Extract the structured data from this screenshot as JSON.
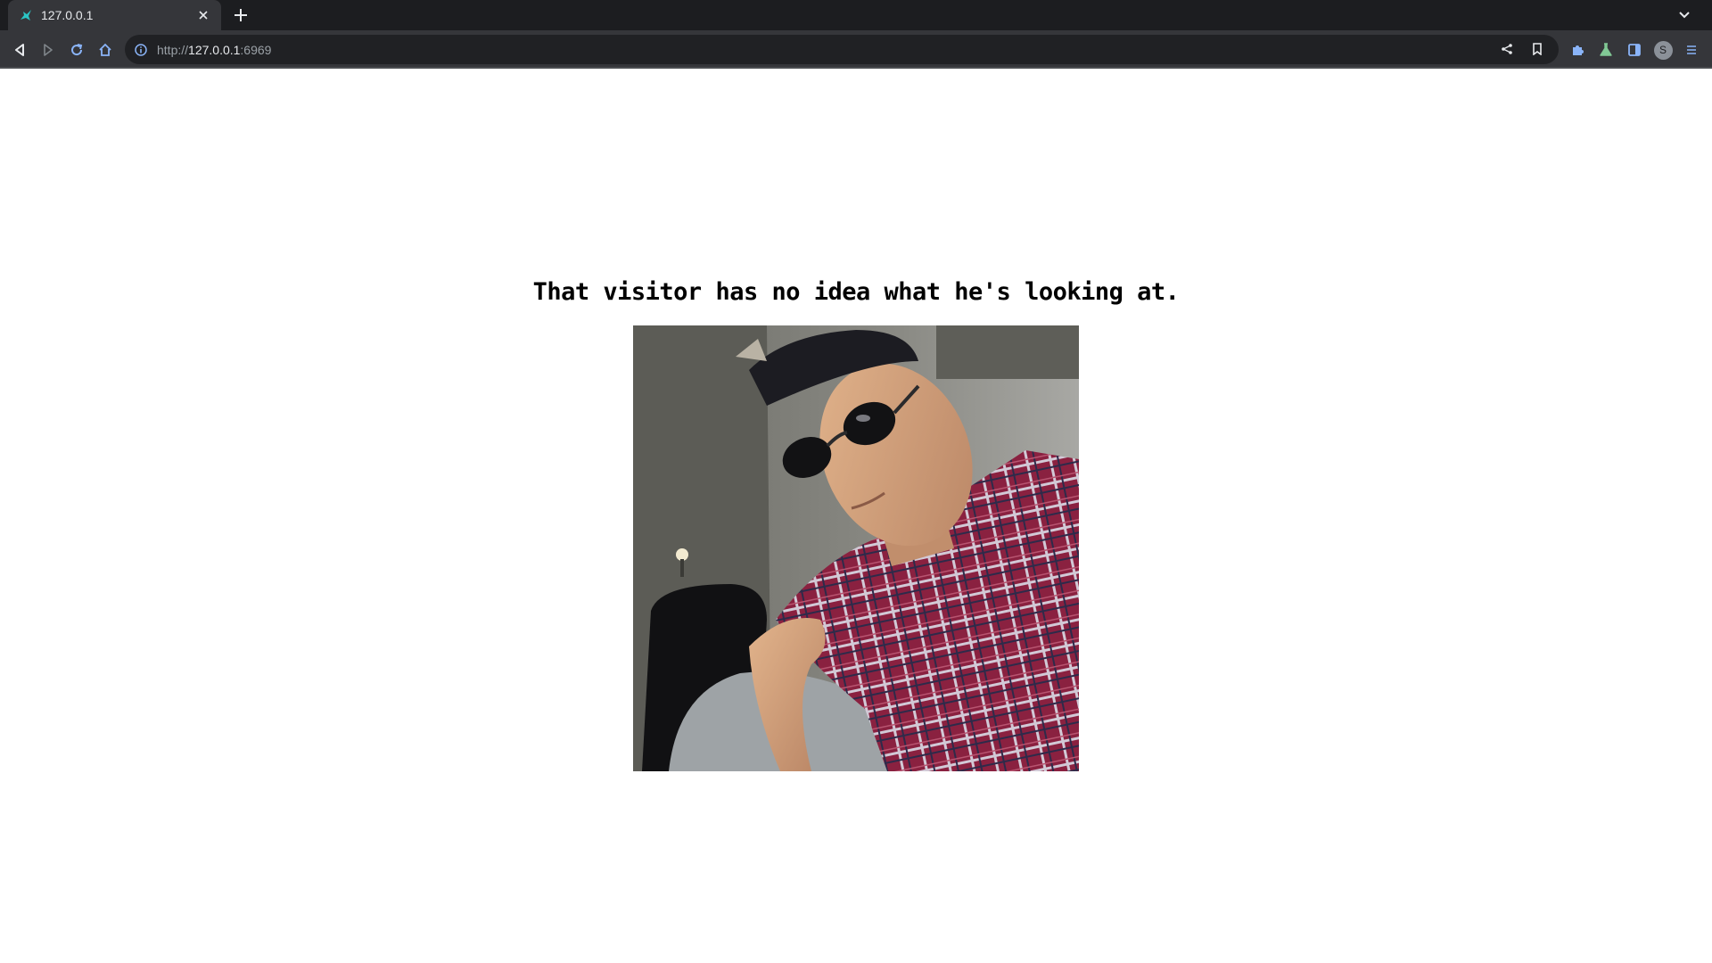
{
  "browser": {
    "tab": {
      "title": "127.0.0.1"
    },
    "omnibox": {
      "scheme": "http://",
      "host": "127.0.0.1",
      "port": ":6969"
    },
    "profile_initial": "S"
  },
  "page": {
    "headline": "That visitor has no idea what he's looking at."
  },
  "icons": {
    "favicon": "bird-favicon-icon",
    "close": "close-icon",
    "new_tab": "plus-icon",
    "tab_search": "chevron-down-icon",
    "back": "back-arrow-icon",
    "forward": "forward-arrow-icon",
    "reload": "reload-icon",
    "home": "home-icon",
    "site_info": "info-icon",
    "share": "share-icon",
    "bookmark": "bookmark-icon",
    "extensions": "puzzle-icon",
    "labs": "flask-icon",
    "side_panel": "side-panel-icon",
    "menu": "menu-icon"
  },
  "colors": {
    "chrome_bg": "#202124",
    "tab_active": "#35363a",
    "accent_blue": "#8ab4f8",
    "favicon_teal": "#2bc4c4"
  }
}
